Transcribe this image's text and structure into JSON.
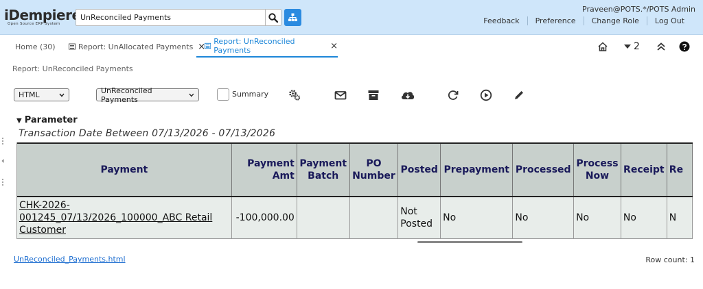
{
  "header": {
    "logo_brand": "iDempiere",
    "logo_tagline": "Open Source ERP System",
    "search_value": "UnReconciled Payments",
    "user": "Praveen@POTS.*/POTS Admin",
    "links": [
      "Feedback",
      "Preference",
      "Change Role",
      "Log Out"
    ]
  },
  "tabs": [
    {
      "label": "Home (30)"
    },
    {
      "label": "Report: UnAllocated Payments"
    },
    {
      "label": "Report: UnReconciled Payments"
    }
  ],
  "tab_close_glyph": "×",
  "toolbar_right": {
    "count": "2"
  },
  "breadcrumb": "Report: UnReconciled Payments",
  "report_toolbar": {
    "format": "HTML",
    "report_view": "UnReconciled Payments",
    "summary_label": "Summary"
  },
  "parameter": {
    "heading": "Parameter",
    "text": "Transaction Date Between 07/13/2026 - 07/13/2026"
  },
  "table": {
    "headers": [
      "Payment",
      "Payment Amt",
      "Payment Batch",
      "PO Number",
      "Posted",
      "Prepayment",
      "Processed",
      "Process Now",
      "Receipt",
      "Re"
    ],
    "rows": [
      [
        "CHK-2026-001245_07/13/2026_100000_ABC Retail Customer",
        "-100,000.00",
        "",
        "",
        "Not Posted",
        "No",
        "No",
        "No",
        "No",
        "N"
      ]
    ]
  },
  "footer": {
    "file_link": "UnReconciled_Payments.html",
    "row_count": "Row count: 1"
  },
  "colors": {
    "accent": "#1c86d8",
    "header_bg": "#cfe6fa"
  }
}
